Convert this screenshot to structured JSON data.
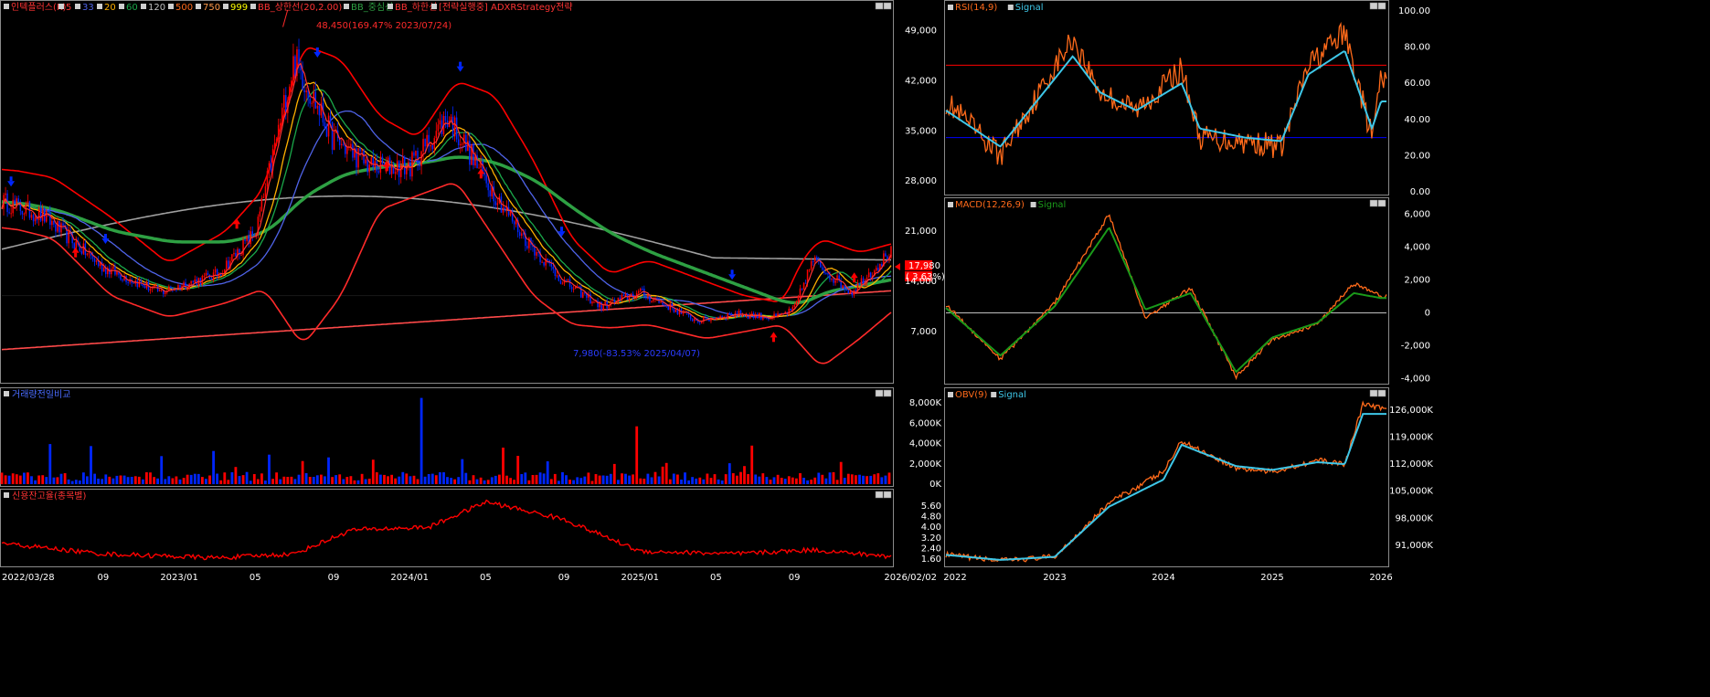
{
  "colors": {
    "bg": "#000000",
    "frame": "#8a8a8a",
    "grid": "#555555",
    "up": "#ff0000",
    "down": "#0026ff",
    "ma5": "#ff3333",
    "ma20": "#ffb000",
    "ma60": "#1aa84a",
    "ma120": "#4f63e8",
    "ma500": "#ff4a4a",
    "ma750": "#a0a0a0",
    "ma999": "#ffff00",
    "bb_upper": "#ff0000",
    "bb_middle": "#2ea043",
    "bb_lower": "#ff2a2a",
    "rsi": "#ff6a1a",
    "rsi_signal": "#3ec7e8",
    "macd": "#ff6a1a",
    "macd_signal": "#1a9a1a",
    "obv": "#ff6a1a",
    "obv_signal": "#3ec7e8",
    "volume_axis": "#ffffff",
    "credit": "#ff0000",
    "price_tag": "#ff0000",
    "annot_high": "#ff0000",
    "annot_low": "#1a1aff",
    "rsi_upper_line": "#ff0000",
    "rsi_lower_line": "#0000ff"
  },
  "main_panel": {
    "legend": [
      {
        "text": "인텍플러스(K)",
        "color": "#ff3333"
      },
      {
        "text": "5",
        "color": "#ff3333"
      },
      {
        "text": "33",
        "color": "#4f63e8"
      },
      {
        "text": "20",
        "color": "#ffb000"
      },
      {
        "text": "60",
        "color": "#1aa84a"
      },
      {
        "text": "120",
        "color": "#c0c0c0"
      },
      {
        "text": "500",
        "color": "#ff6a1a"
      },
      {
        "text": "750",
        "color": "#ff9a4a"
      },
      {
        "text": "999",
        "color": "#ffff00"
      },
      {
        "text": "BB_상한선(20,2.00)",
        "color": "#ff3333"
      },
      {
        "text": "BB_중심선",
        "color": "#2ea043"
      },
      {
        "text": "BB_하한선",
        "color": "#ff3333"
      },
      {
        "text": "[전략실행중] ADXRStrategy전략",
        "color": "#ff3333"
      }
    ],
    "y_ticks": [
      "49,000",
      "42,000",
      "35,000",
      "28,000",
      "21,000",
      "14,000",
      "7,000"
    ],
    "high_annotation": "48,450(169.47% 2023/07/24)",
    "low_annotation": "7,980(-83.53% 2025/04/07)",
    "price_tag": "17,980",
    "price_change": "( 3.63%)"
  },
  "volume_panel": {
    "legend": "거래량전일비교",
    "y_ticks": [
      "8,000K",
      "6,000K",
      "4,000K",
      "2,000K",
      "0K"
    ]
  },
  "credit_panel": {
    "legend": "신용잔고율(종목별)",
    "y_ticks": [
      "5.60",
      "4.80",
      "4.00",
      "3.20",
      "2.40",
      "1.60"
    ]
  },
  "rsi_panel": {
    "legend": [
      {
        "text": "RSI(14,9)",
        "color": "#ff6a1a"
      },
      {
        "text": "Signal",
        "color": "#3ec7e8"
      }
    ],
    "y_ticks": [
      "100.00",
      "80.00",
      "60.00",
      "40.00",
      "20.00",
      "0.00"
    ]
  },
  "macd_panel": {
    "legend": [
      {
        "text": "MACD(12,26,9)",
        "color": "#ff6a1a"
      },
      {
        "text": "Signal",
        "color": "#1a9a1a"
      }
    ],
    "y_ticks": [
      "6,000",
      "4,000",
      "2,000",
      "0",
      "-2,000",
      "-4,000"
    ]
  },
  "obv_panel": {
    "legend": [
      {
        "text": "OBV(9)",
        "color": "#ff6a1a"
      },
      {
        "text": "Signal",
        "color": "#3ec7e8"
      }
    ],
    "y_ticks": [
      "126,000K",
      "119,000K",
      "112,000K",
      "105,000K",
      "98,000K",
      "91,000K"
    ]
  },
  "left_x_axis": [
    "2022/03/28",
    "09",
    "2023/01",
    "05",
    "09",
    "2024/01",
    "05",
    "09",
    "2025/01",
    "05",
    "09",
    "2026/02/02"
  ],
  "right_x_axis": [
    "2022",
    "2023",
    "2024",
    "2025",
    "2026"
  ],
  "chart_data": [
    {
      "type": "line",
      "name": "인텍플러스(K) price",
      "x": [
        "2022-03",
        "2022-06",
        "2022-09",
        "2022-12",
        "2023-03",
        "2023-05",
        "2023-07",
        "2023-09",
        "2023-11",
        "2024-01",
        "2024-03",
        "2024-05",
        "2024-07",
        "2024-09",
        "2024-11",
        "2025-01",
        "2025-04",
        "2025-06",
        "2025-08",
        "2025-09",
        "2025-10",
        "2025-12",
        "2026-02"
      ],
      "series": [
        {
          "name": "Close",
          "values": [
            26000,
            23000,
            16000,
            12500,
            15000,
            21000,
            45000,
            34000,
            30000,
            30000,
            37000,
            28000,
            20000,
            14000,
            10500,
            12500,
            8500,
            9500,
            9000,
            10000,
            17000,
            12500,
            17980
          ]
        },
        {
          "name": "BB_상한선",
          "values": [
            30000,
            28500,
            23000,
            16500,
            21000,
            27000,
            47000,
            45000,
            37000,
            34000,
            42000,
            40000,
            31000,
            20000,
            15000,
            17000,
            14000,
            12000,
            11000,
            17000,
            20000,
            18000,
            19500
          ]
        },
        {
          "name": "BB_중심선",
          "values": [
            25500,
            24000,
            21000,
            19500,
            19500,
            21000,
            26000,
            29000,
            30000,
            30500,
            31500,
            30500,
            28000,
            24000,
            20500,
            18000,
            15000,
            13000,
            11000,
            11000,
            12500,
            13500,
            14500
          ]
        },
        {
          "name": "BB_하한선",
          "values": [
            22000,
            20000,
            12000,
            9000,
            11000,
            13000,
            5000,
            12000,
            24000,
            26000,
            28000,
            20000,
            12000,
            8000,
            7500,
            8000,
            6000,
            7000,
            8000,
            5000,
            2000,
            6000,
            10500
          ]
        }
      ],
      "ylim": [
        0,
        53000
      ]
    },
    {
      "type": "bar",
      "name": "거래량전일비교",
      "ylim": [
        0,
        9000
      ],
      "unit": "K",
      "peak_values": [
        4000,
        8500,
        5700,
        3600,
        5200,
        2500
      ]
    },
    {
      "type": "line",
      "name": "신용잔고율(종목별)",
      "ylim": [
        1.2,
        6.2
      ],
      "x": [
        "2022-03",
        "2022-09",
        "2023-03",
        "2023-07",
        "2023-10",
        "2024-02",
        "2024-05",
        "2024-09",
        "2025-01",
        "2025-06",
        "2025-10",
        "2026-02"
      ],
      "values": [
        2.9,
        2.0,
        1.7,
        2.0,
        3.8,
        4.0,
        5.9,
        4.6,
        2.2,
        2.0,
        2.3,
        1.8
      ]
    },
    {
      "type": "line",
      "name": "RSI(14,9)",
      "ylim": [
        0,
        100
      ],
      "x": [
        "2022-01",
        "2022-07",
        "2023-03",
        "2023-06",
        "2023-10",
        "2024-03",
        "2024-05",
        "2024-10",
        "2025-02",
        "2025-05",
        "2025-09",
        "2025-12",
        "2026-01"
      ],
      "series": [
        {
          "name": "RSI",
          "values": [
            50,
            20,
            85,
            55,
            45,
            68,
            30,
            28,
            25,
            70,
            88,
            30,
            62
          ]
        },
        {
          "name": "Signal",
          "values": [
            45,
            25,
            75,
            55,
            45,
            60,
            35,
            30,
            28,
            65,
            78,
            35,
            50
          ]
        }
      ],
      "levels": [
        70,
        30
      ]
    },
    {
      "type": "line",
      "name": "MACD(12,26,9)",
      "ylim": [
        -4200,
        6700
      ],
      "x": [
        "2022-01",
        "2022-07",
        "2023-01",
        "2023-07",
        "2023-11",
        "2024-04",
        "2024-09",
        "2025-01",
        "2025-06",
        "2025-10",
        "2026-01"
      ],
      "series": [
        {
          "name": "MACD",
          "values": [
            500,
            -2800,
            600,
            6000,
            -300,
            1500,
            -3900,
            -1600,
            -700,
            1800,
            1000
          ]
        },
        {
          "name": "Signal",
          "values": [
            300,
            -2600,
            400,
            5200,
            200,
            1200,
            -3600,
            -1500,
            -600,
            1200,
            900
          ]
        }
      ]
    },
    {
      "type": "line",
      "name": "OBV(9)",
      "ylim": [
        86000,
        130000
      ],
      "x": [
        "2022-01",
        "2022-07",
        "2023-01",
        "2023-07",
        "2024-01",
        "2024-03",
        "2024-09",
        "2025-01",
        "2025-06",
        "2025-09",
        "2025-11",
        "2026-01"
      ],
      "series": [
        {
          "name": "OBV",
          "values": [
            88500,
            87000,
            88000,
            102000,
            110000,
            118000,
            111000,
            110000,
            113000,
            112000,
            127500,
            126500
          ]
        },
        {
          "name": "Signal",
          "values": [
            88500,
            87200,
            88000,
            101000,
            108000,
            117000,
            111500,
            110500,
            112500,
            112000,
            125000,
            125000
          ]
        }
      ]
    }
  ]
}
